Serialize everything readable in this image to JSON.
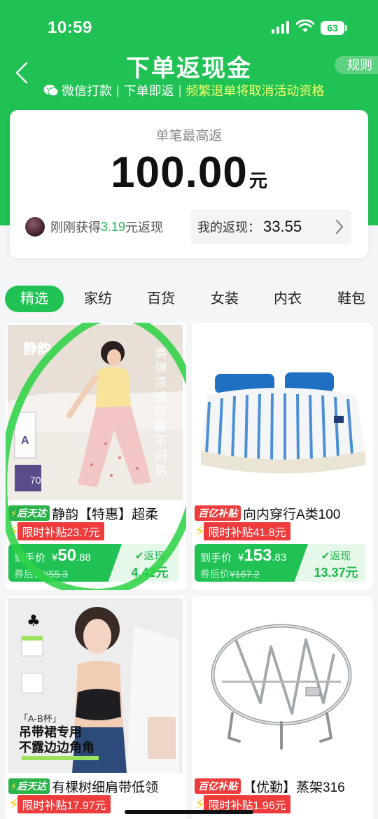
{
  "status": {
    "time": "10:59",
    "battery": "63"
  },
  "header": {
    "title": "下单返现金",
    "rules_label": "规则",
    "sub1": "微信打款",
    "sep": "|",
    "sub2": "下单即返",
    "sub3": "频繁退单将取消活动资格"
  },
  "summary": {
    "label": "单笔最高返",
    "amount": "100.00",
    "unit": "元",
    "recent_prefix": "刚刚获得",
    "recent_value": "3.19",
    "recent_suffix": "元返现",
    "my_label": "我的返现：",
    "my_value": "33.55"
  },
  "tabs": [
    "精选",
    "家纺",
    "百货",
    "女装",
    "内衣",
    "鞋包"
  ],
  "products": [
    {
      "badge": "后天达",
      "title": "静韵【特惠】超柔",
      "subsidy": "限时补贴23.7元",
      "price_label": "到手价",
      "currency": "¥",
      "price_int": "50",
      "price_dec": ".88",
      "orig_label": "券后价",
      "orig_price": "¥55.3",
      "cashback_label": "返现",
      "cashback": "4.42元",
      "image_texts": [
        "静韵",
        "高弹凉感秒睡不闷热",
        "A",
        "70"
      ]
    },
    {
      "badge": "百亿补贴",
      "title": "向内穿行A类100",
      "subsidy": "限时补贴41.8元",
      "price_label": "到手价",
      "currency": "¥",
      "price_int": "153",
      "price_dec": ".83",
      "orig_label": "券后价",
      "orig_price": "¥167.2",
      "cashback_label": "返现",
      "cashback": "13.37元"
    },
    {
      "badge": "后天达",
      "title": "有棵树细肩带低领",
      "subsidy": "限时补贴17.97元",
      "image_texts": [
        "「A-B杯」",
        "吊带裙专用",
        "不露边边角角"
      ]
    },
    {
      "badge": "百亿补贴",
      "title": "【优勤】蒸架316",
      "subsidy": "限时补贴1.96元"
    }
  ]
}
